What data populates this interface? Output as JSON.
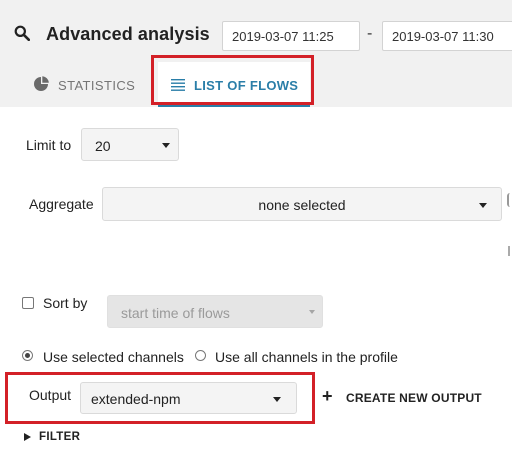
{
  "header": {
    "title": "Advanced analysis",
    "search_icon": "search-icon",
    "date_from": "2019-03-07 11:25",
    "date_separator": "-",
    "date_to": "2019-03-07 11:30"
  },
  "tabs": [
    {
      "label": "STATISTICS",
      "icon": "pie-chart-icon",
      "active": false
    },
    {
      "label": "LIST OF FLOWS",
      "icon": "list-icon",
      "active": true
    }
  ],
  "form": {
    "limit_label": "Limit to",
    "limit_value": "20",
    "aggregate_label": "Aggregate",
    "aggregate_value": "none selected",
    "sort_label": "Sort by",
    "sort_checked": false,
    "sort_value": "start time of flows",
    "channels_option_selected": "Use selected channels",
    "channels_option_all": "Use all channels in the profile",
    "output_label": "Output",
    "output_value": "extended-npm",
    "create_output_label": "CREATE NEW OUTPUT",
    "filter_label": "FILTER"
  },
  "colors": {
    "accent": "#2a7ea8",
    "highlight": "#d32027",
    "header_bg": "#f1f1f1"
  }
}
